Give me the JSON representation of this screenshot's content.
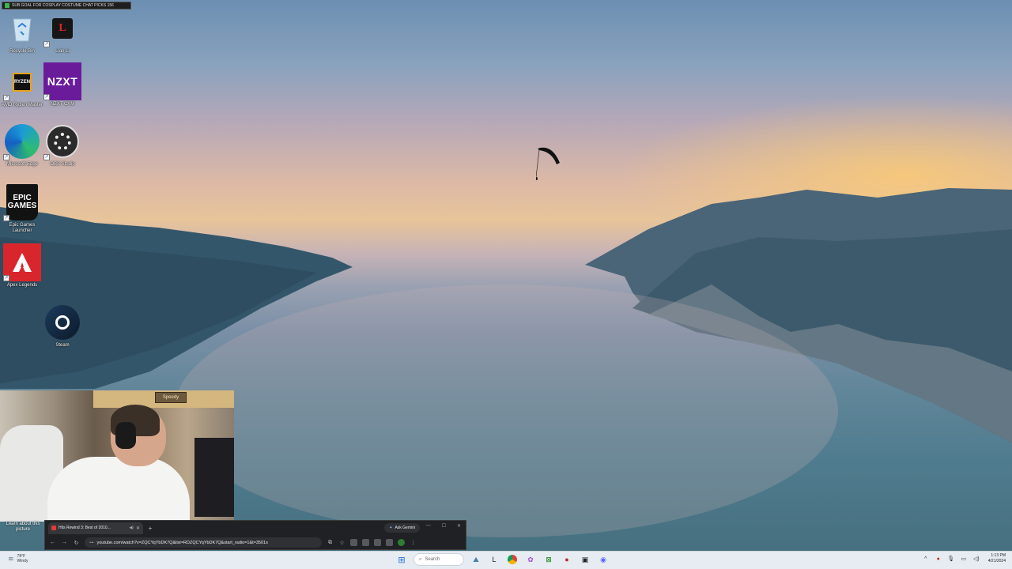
{
  "recording_banner": {
    "text": "SUB GOAL FOR COSPLAY COSTUME CHAT PICKS 156"
  },
  "desktop_icons": [
    {
      "label": "Recycle Bin",
      "icon": "recycle-bin-icon"
    },
    {
      "label": "Lian Li",
      "icon": "l-connect-icon"
    },
    {
      "label": "AMD Ryzen Master",
      "icon": "ryzen-icon"
    },
    {
      "label": "NZXT CAM",
      "icon": "nzxt-icon",
      "glyph_text": "NZXT"
    },
    {
      "label": "Microsoft Edge",
      "icon": "edge-icon"
    },
    {
      "label": "OBS Studio",
      "icon": "obs-icon"
    },
    {
      "label": "Epic Games Launcher",
      "icon": "epic-games-icon",
      "glyph_text": "EPIC GAMES"
    },
    {
      "label": "Apex Legends",
      "icon": "apex-icon"
    },
    {
      "label": "Steam",
      "icon": "steam-icon"
    }
  ],
  "webcam": {
    "sign_text": "Speedy"
  },
  "spotlight": {
    "text": "Learn about this picture"
  },
  "chrome": {
    "tab_title": "Hits Rewind 3: Best of 2010...",
    "new_tab_label": "+",
    "gemini_label": "Ask Gemini",
    "url": "youtube.com/watch?v=ZQCYqYbDK7Q&list=RDZQCYqYbDK7Q&start_radio=1&t=3501s"
  },
  "taskbar": {
    "weather_temp": "78°F",
    "weather_desc": "Windy",
    "search_placeholder": "Search",
    "time": "1:13 PM",
    "date": "4/21/2024"
  },
  "colors": {
    "taskbar_bg": "#e6ecf2",
    "chrome_bg": "#202124",
    "nzxt_purple": "#6a1b9a",
    "apex_red": "#d9262c"
  }
}
